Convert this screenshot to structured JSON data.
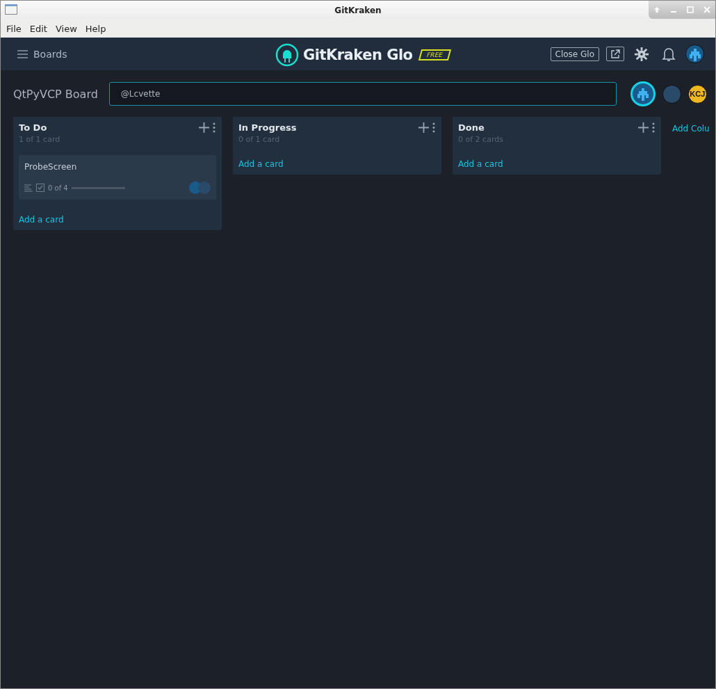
{
  "window": {
    "title": "GitKraken"
  },
  "menu": [
    "File",
    "Edit",
    "View",
    "Help"
  ],
  "header": {
    "boards_label": "Boards",
    "logo_text": "GitKraken Glo",
    "plan_badge": "FREE",
    "close_button": "Close Glo"
  },
  "board": {
    "title": "QtPyVCP Board",
    "filter": {
      "value": "@Lcvette"
    },
    "members": [
      {
        "kind": "pixel",
        "selected": true
      },
      {
        "kind": "photo",
        "selected": false
      },
      {
        "kind": "initials",
        "initials": "KCJ",
        "selected": false
      }
    ]
  },
  "columns": [
    {
      "title": "To Do",
      "count": "1 of 1 card",
      "cards": [
        {
          "title": "ProbeScreen",
          "checklist": "0 of 4",
          "level": 0
        }
      ],
      "add_card": "Add a card"
    },
    {
      "title": "In Progress",
      "count": "0 of 1 card",
      "add_card": "Add a card"
    },
    {
      "title": "Done",
      "count": "0 of 2 cards",
      "add_card": "Add a card"
    }
  ],
  "add_column": "Add Colu"
}
